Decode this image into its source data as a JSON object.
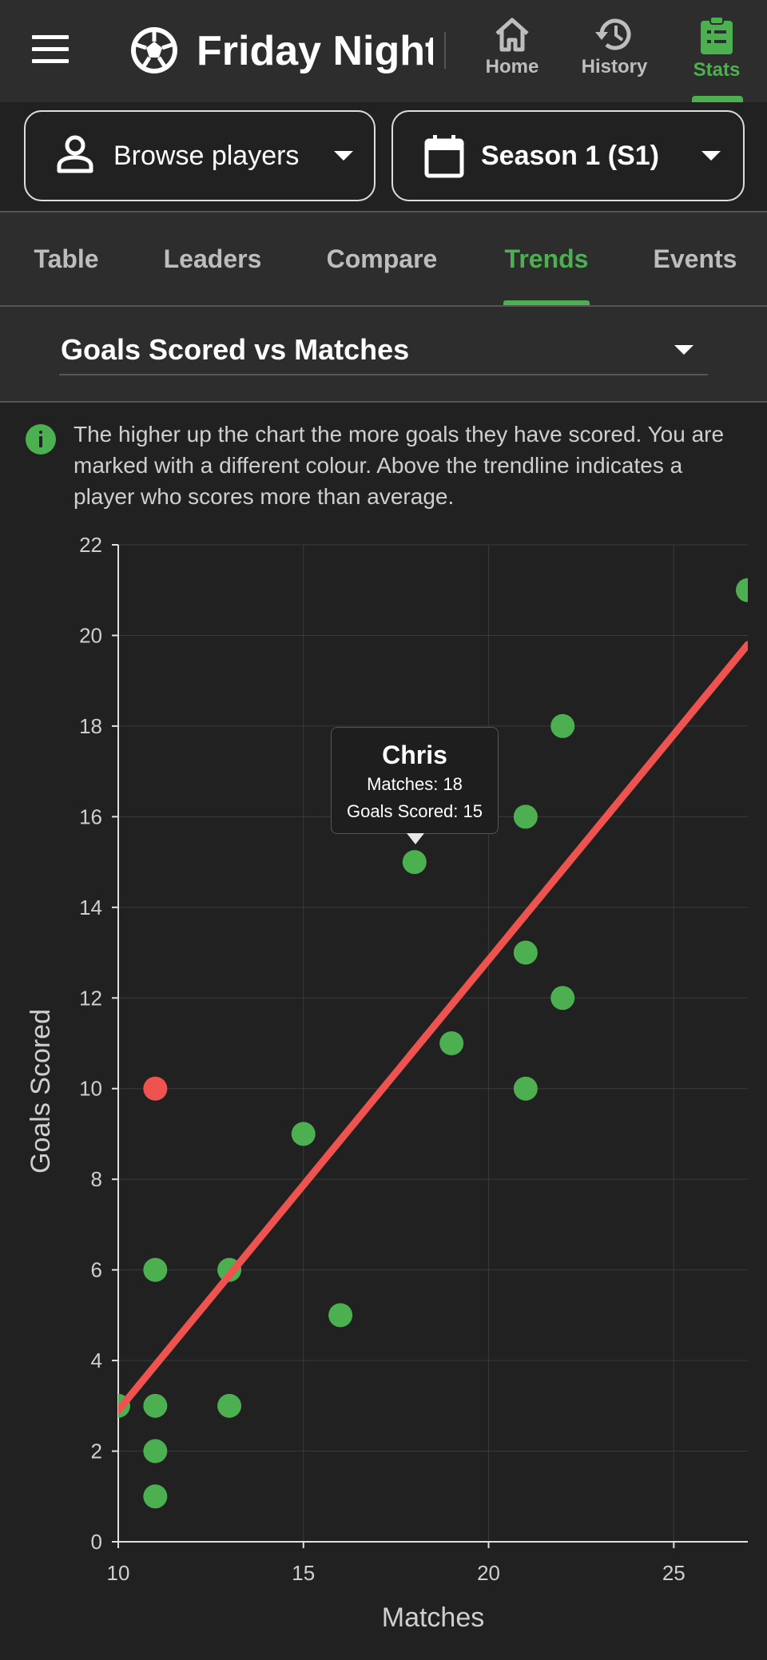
{
  "app": {
    "title": "Friday Night",
    "nav": [
      {
        "label": "Home",
        "icon": "home-icon",
        "active": false
      },
      {
        "label": "History",
        "icon": "history-icon",
        "active": false
      },
      {
        "label": "Stats",
        "icon": "clipboard-list-icon",
        "active": true
      }
    ]
  },
  "selectors": {
    "player": {
      "label": "Browse players",
      "icon": "person-icon"
    },
    "season": {
      "label": "Season 1 (S1)",
      "icon": "calendar-icon"
    }
  },
  "tabs": [
    {
      "label": "Table",
      "active": false
    },
    {
      "label": "Leaders",
      "active": false
    },
    {
      "label": "Compare",
      "active": false
    },
    {
      "label": "Trends",
      "active": true
    },
    {
      "label": "Events",
      "active": false
    }
  ],
  "metric": {
    "selected": "Goals Scored vs Matches"
  },
  "info": {
    "text": "The higher up the chart the more goals they have scored. You are marked with a different colour. Above the trendline indicates a player who scores more than average."
  },
  "tooltip": {
    "name": "Chris",
    "line1": "Matches: 18",
    "line2": "Goals Scored: 15"
  },
  "colors": {
    "accent": "#4caf50",
    "highlight": "#ef5350",
    "trendline": "#ef5350",
    "background": "#212121",
    "surface": "#2d2d2d"
  },
  "chart_data": {
    "type": "scatter",
    "xlabel": "Matches",
    "ylabel": "Goals Scored",
    "xlim": [
      10,
      27
    ],
    "ylim": [
      0,
      22
    ],
    "xticks": [
      10,
      15,
      20,
      25
    ],
    "yticks": [
      0,
      2,
      4,
      6,
      8,
      10,
      12,
      14,
      16,
      18,
      20,
      22
    ],
    "grid": true,
    "points": [
      {
        "x": 10,
        "y": 3,
        "self": false
      },
      {
        "x": 11,
        "y": 10,
        "self": true
      },
      {
        "x": 11,
        "y": 6,
        "self": false
      },
      {
        "x": 11,
        "y": 3,
        "self": false
      },
      {
        "x": 11,
        "y": 2,
        "self": false
      },
      {
        "x": 11,
        "y": 1,
        "self": false
      },
      {
        "x": 13,
        "y": 6,
        "self": false
      },
      {
        "x": 13,
        "y": 3,
        "self": false
      },
      {
        "x": 15,
        "y": 9,
        "self": false
      },
      {
        "x": 16,
        "y": 5,
        "self": false
      },
      {
        "x": 18,
        "y": 15,
        "self": false
      },
      {
        "x": 19,
        "y": 11,
        "self": false
      },
      {
        "x": 21,
        "y": 16,
        "self": false
      },
      {
        "x": 21,
        "y": 13,
        "self": false
      },
      {
        "x": 21,
        "y": 10,
        "self": false
      },
      {
        "x": 22,
        "y": 18,
        "self": false
      },
      {
        "x": 22,
        "y": 12,
        "self": false
      },
      {
        "x": 27,
        "y": 21,
        "self": false
      }
    ],
    "trendline": {
      "x": [
        10,
        27
      ],
      "y": [
        2.9,
        19.8
      ]
    }
  }
}
